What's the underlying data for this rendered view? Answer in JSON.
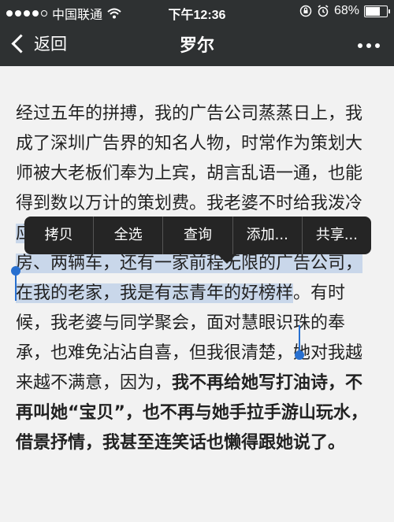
{
  "status_bar": {
    "carrier": "中国联通",
    "time": "下午12:36",
    "battery_percent": "68%",
    "battery_level": 0.68
  },
  "nav": {
    "back_label": "返回",
    "title": "罗尔"
  },
  "article": {
    "para1": "经过五年的拼搏，我的广告公司蒸蒸日上，我成了深圳广告界的知名人物，时常作为策划大师被大老板们奉为上宾，胡言乱语一通，也能得到数以万计的策划费。我老婆不时给我泼冷",
    "para2_selected": "应该说，我的努力还是有成绩的，我有三套房、两辆车，还有一家前程无限的广告公司，在我的老家，我是有志青年的好榜样",
    "para2_rest": "。有时候，我老婆与同学聚会，面对慧眼识珠的奉承，也难免沾沾自喜，但我很清楚，她对我越来越不满意，因为，",
    "para2_bold": "我不再给她写打油诗，不再叫她“宝贝”，也不再与她手拉手游山玩水，借景抒情，我甚至连笑话也懒得跟她说了。"
  },
  "context_menu": {
    "items": [
      "拷贝",
      "全选",
      "查询",
      "添加...",
      "共享..."
    ]
  }
}
